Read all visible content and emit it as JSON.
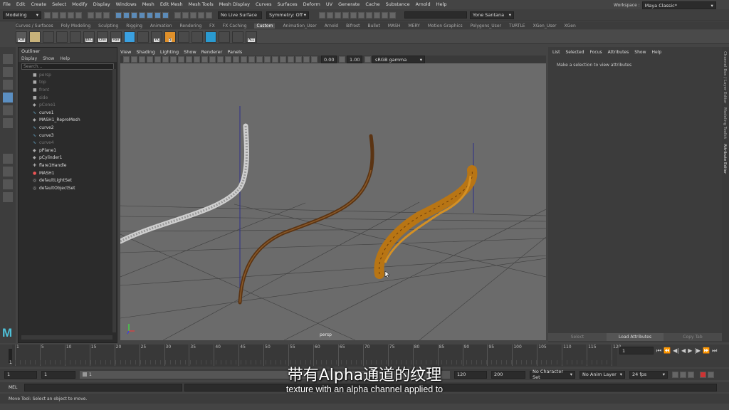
{
  "menubar": [
    "File",
    "Edit",
    "Create",
    "Select",
    "Modify",
    "Display",
    "Windows",
    "Mesh",
    "Edit Mesh",
    "Mesh Tools",
    "Mesh Display",
    "Curves",
    "Surfaces",
    "Deform",
    "UV",
    "Generate",
    "Cache",
    "Substance",
    "Arnold",
    "Help"
  ],
  "workspace": {
    "label": "Workspace :",
    "value": "Maya Classic*"
  },
  "status": {
    "mode": "Modeling",
    "live_surface": "No Live Surface",
    "symmetry": "Symmetry: Off",
    "user": "Yone Santana"
  },
  "shelf_tabs": [
    "Curves / Surfaces",
    "Poly Modeling",
    "Sculpting",
    "Rigging",
    "Animation",
    "Rendering",
    "FX",
    "FX Caching",
    "Custom",
    "Animation_User",
    "Arnold",
    "Bifrost",
    "Bullet",
    "MASH",
    "MERY",
    "Motion Graphics",
    "Polygons_User",
    "TURTLE",
    "XGen_User",
    "XGen"
  ],
  "shelf_active": "Custom",
  "shelf_icons": [
    {
      "name": "align-icon",
      "label": "ALN",
      "color": "#5a5a5a"
    },
    {
      "name": "texture-icon",
      "label": "",
      "color": "#c8b27a"
    },
    {
      "name": "minus-icon",
      "label": "",
      "color": "#4a4a4a"
    },
    {
      "name": "plus-red-icon",
      "label": "",
      "color": "#4a4a4a"
    },
    {
      "name": "mash-m-icon",
      "label": "",
      "color": "#4a4a4a"
    },
    {
      "name": "del-icon",
      "label": "DEL",
      "color": "#4a4a4a"
    },
    {
      "name": "chin-icon",
      "label": "Chin",
      "color": "#4a4a4a"
    },
    {
      "name": "hair-icon",
      "label": "Hair",
      "color": "#4a4a4a"
    },
    {
      "name": "blue-square-icon",
      "label": "",
      "color": "#3aa0e0"
    },
    {
      "name": "ghost-icon",
      "label": "",
      "color": "#4a4a4a"
    },
    {
      "name": "yk-icon",
      "label": "YK",
      "color": "#4a4a4a"
    },
    {
      "name": "five-icon",
      "label": "5",
      "color": "#e0902a"
    },
    {
      "name": "person-icon",
      "label": "",
      "color": "#4a4a4a"
    },
    {
      "name": "skull-icon",
      "label": "",
      "color": "#4a4a4a"
    },
    {
      "name": "t-pose-icon",
      "label": "",
      "color": "#2a9ad0"
    },
    {
      "name": "m-icon-1",
      "label": "",
      "color": "#4a4a4a"
    },
    {
      "name": "m-icon-2",
      "label": "",
      "color": "#4a4a4a"
    },
    {
      "name": "all-icon",
      "label": "ALL",
      "color": "#4a4a4a"
    }
  ],
  "outliner": {
    "title": "Outliner",
    "menu": [
      "Display",
      "Show",
      "Help"
    ],
    "search_placeholder": "Search...",
    "items": [
      {
        "label": "persp",
        "dim": true,
        "icon": "camera"
      },
      {
        "label": "top",
        "dim": true,
        "icon": "camera"
      },
      {
        "label": "front",
        "dim": true,
        "icon": "camera"
      },
      {
        "label": "side",
        "dim": true,
        "icon": "camera"
      },
      {
        "label": "pCone1",
        "dim": true,
        "icon": "mesh"
      },
      {
        "label": "curve1",
        "dim": false,
        "icon": "curve"
      },
      {
        "label": "MASH1_ReproMesh",
        "dim": false,
        "icon": "mesh"
      },
      {
        "label": "curve2",
        "dim": false,
        "icon": "curve"
      },
      {
        "label": "curve3",
        "dim": false,
        "icon": "curve"
      },
      {
        "label": "curve4",
        "dim": true,
        "icon": "curve"
      },
      {
        "label": "pPlane1",
        "dim": false,
        "icon": "mesh"
      },
      {
        "label": "pCylinder1",
        "dim": false,
        "icon": "mesh"
      },
      {
        "label": "flare1Handle",
        "dim": false,
        "icon": "handle"
      },
      {
        "label": "MASH1",
        "dim": false,
        "icon": "mash"
      },
      {
        "label": "defaultLightSet",
        "dim": false,
        "icon": "set"
      },
      {
        "label": "defaultObjectSet",
        "dim": false,
        "icon": "set"
      }
    ]
  },
  "viewport": {
    "menu": [
      "View",
      "Shading",
      "Lighting",
      "Show",
      "Renderer",
      "Panels"
    ],
    "exposure": "0.00",
    "gamma": "1.00",
    "color_space": "sRGB gamma",
    "camera_label": "persp"
  },
  "attribute_editor": {
    "menu": [
      "List",
      "Selected",
      "Focus",
      "Attributes",
      "Show",
      "Help"
    ],
    "message": "Make a selection to view attributes",
    "buttons": [
      "Select",
      "Load Attributes",
      "Copy Tab"
    ]
  },
  "side_tabs": [
    "Channel Box / Layer Editor",
    "Modeling Toolkit",
    "Attribute Editor"
  ],
  "timeline": {
    "ticks": [
      "1",
      "5",
      "10",
      "15",
      "20",
      "25",
      "30",
      "35",
      "40",
      "45",
      "50",
      "55",
      "60",
      "65",
      "70",
      "75",
      "80",
      "85",
      "90",
      "95",
      "100",
      "105",
      "110",
      "115",
      "120"
    ],
    "current_frame": "1",
    "start_left": "1",
    "start_right": "1",
    "range_start": "1",
    "range_end": "120",
    "end": "120",
    "max": "200",
    "character_set": "No Character Set",
    "anim_layer": "No Anim Layer",
    "fps": "24 fps"
  },
  "mel_label": "MEL",
  "help_line": "Move Tool: Select an object to move.",
  "subtitles": {
    "chinese": "带有Alpha通道的纹理",
    "english": "texture with an alpha channel applied to"
  }
}
